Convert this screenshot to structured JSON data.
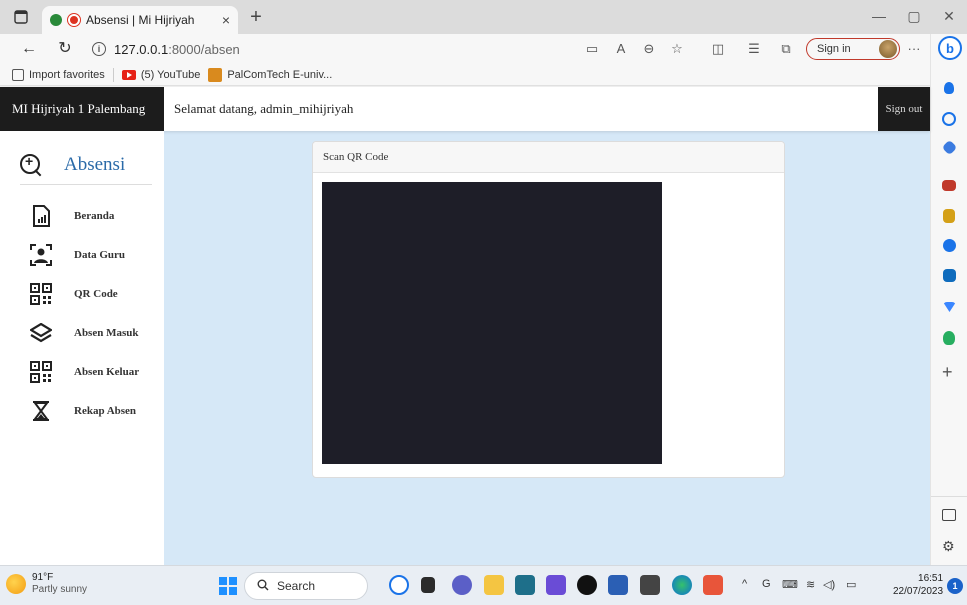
{
  "browser": {
    "tab_title": "Absensi | Mi Hijriyah",
    "tab_close": "×",
    "new_tab": "+",
    "url_host": "127.0.0.1",
    "url_path": ":8000/absen",
    "signin_label": "Sign in",
    "more": "···",
    "favorites": [
      {
        "label": "Import favorites",
        "icon": "import-icon"
      },
      {
        "label": "(5) YouTube",
        "icon": "youtube-icon"
      },
      {
        "label": "PalComTech E-univ...",
        "icon": "palcomtech-icon"
      }
    ],
    "window_controls": {
      "minimize": "—",
      "restore": "▢",
      "close": "✕"
    }
  },
  "app": {
    "brand": "MI Hijriyah 1 Palembang",
    "welcome": "Selamat datang, admin_mihijriyah",
    "signout": "Sign out",
    "sidebar_title": "Absensi",
    "menu": [
      {
        "label": "Beranda",
        "icon": "report-icon"
      },
      {
        "label": "Data Guru",
        "icon": "person-scan-icon"
      },
      {
        "label": "QR Code",
        "icon": "qr-code-icon"
      },
      {
        "label": "Absen Masuk",
        "icon": "layers-icon"
      },
      {
        "label": "Absen Keluar",
        "icon": "qr-code-icon"
      },
      {
        "label": "Rekap Absen",
        "icon": "hourglass-icon"
      }
    ],
    "card_title": "Scan QR Code"
  },
  "taskbar": {
    "temp": "91°F",
    "weather": "Partly sunny",
    "search": "Search",
    "time": "16:51",
    "date": "22/07/2023",
    "notifications": "1"
  },
  "colors": {
    "page_bg": "#d6e8f7",
    "navbar_dark": "#1c1c1c",
    "sidebar_title": "#2a6aa8",
    "video_bg": "#1e1e28"
  }
}
